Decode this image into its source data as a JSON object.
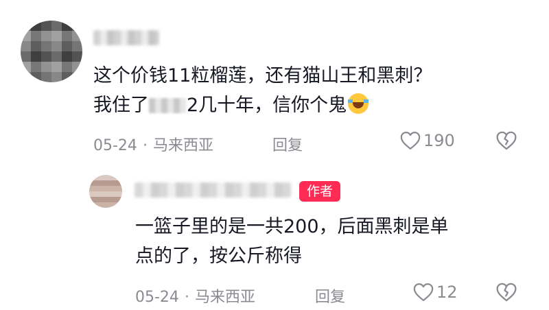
{
  "comments": [
    {
      "text_line1": "这个价钱11粒榴莲，还有猫山王和黑刺？",
      "text_line2_prefix": "我住了",
      "text_line2_suffix": "2几十年，信你个鬼",
      "date": "05-24",
      "separator": "·",
      "location": "马来西亚",
      "reply_label": "回复",
      "likes": "190"
    },
    {
      "badge": "作者",
      "text_line1": "一篮子里的是一共200，后面黑刺是单",
      "text_line2": "点的了，按公斤称得",
      "date": "05-24",
      "separator": "·",
      "location": "马来西亚",
      "reply_label": "回复",
      "likes": "12"
    }
  ],
  "icons": {
    "like": "heart-outline-icon",
    "dislike": "broken-heart-icon",
    "emoji": "rolling-laughing-emoji"
  },
  "colors": {
    "author_badge": "#fe2c55",
    "meta_text": "#8a8b91"
  }
}
